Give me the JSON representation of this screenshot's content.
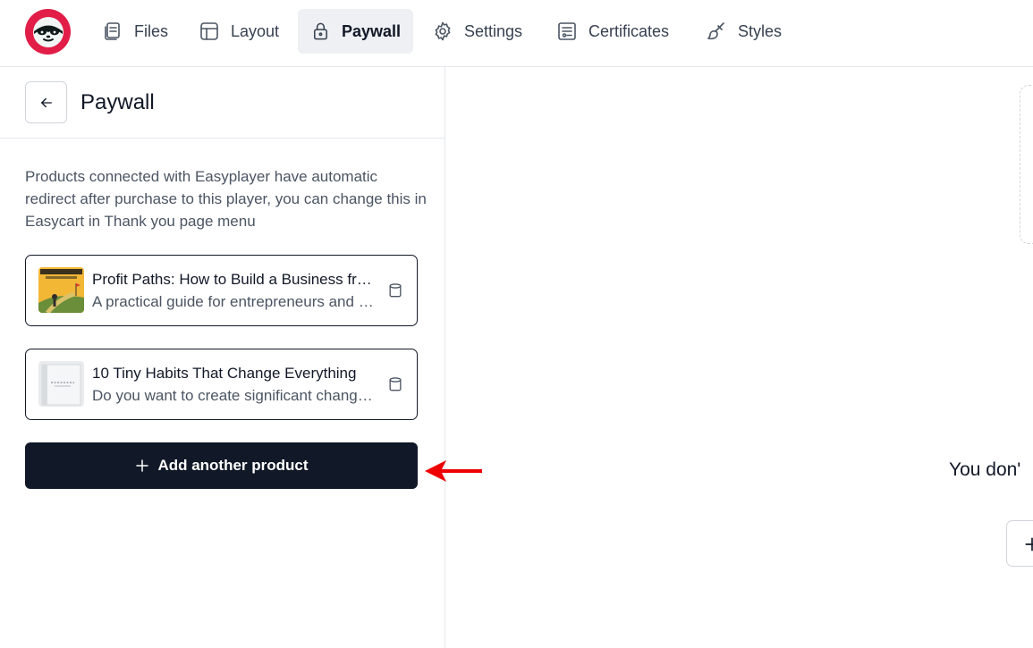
{
  "nav": {
    "items": [
      {
        "label": "Files",
        "icon": "files-icon",
        "active": false
      },
      {
        "label": "Layout",
        "icon": "layout-icon",
        "active": false
      },
      {
        "label": "Paywall",
        "icon": "lock-icon",
        "active": true
      },
      {
        "label": "Settings",
        "icon": "gear-icon",
        "active": false
      },
      {
        "label": "Certificates",
        "icon": "certificate-icon",
        "active": false
      },
      {
        "label": "Styles",
        "icon": "brush-icon",
        "active": false
      }
    ]
  },
  "sidebar": {
    "title": "Paywall",
    "description": "Products connected with Easyplayer have automatic redirect after purchase to this player, you can change this in Easycart in Thank you page menu",
    "products": [
      {
        "title": "Profit Paths: How to Build a Business from Scratch",
        "description": "A practical guide for entrepreneurs and small business owners"
      },
      {
        "title": "10 Tiny Habits That Change Everything",
        "description": "Do you want to create significant changes in your life?"
      }
    ],
    "add_button_label": "Add another product"
  },
  "main": {
    "empty_text": "You don'"
  },
  "colors": {
    "brand": "#e11d48",
    "primary_button": "#111827",
    "annotation_arrow": "#ee0000"
  }
}
